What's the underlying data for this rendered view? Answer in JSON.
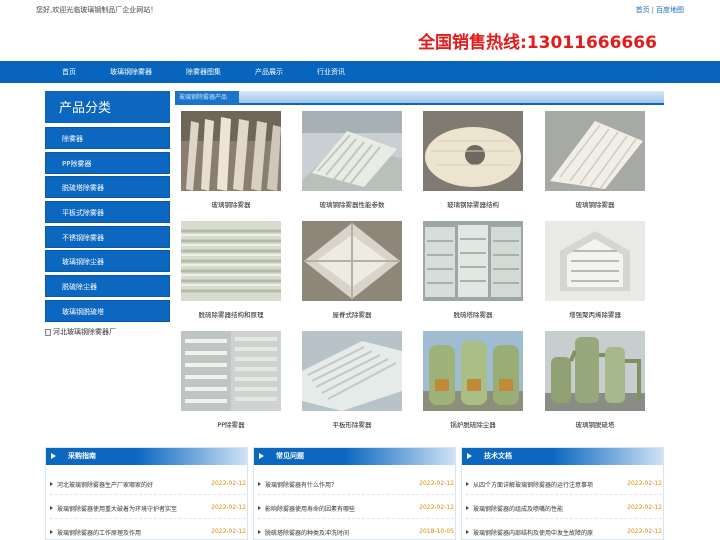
{
  "header": {
    "welcome": "您好,欢迎光临玻璃钢制品厂企业网站！",
    "links": [
      "首页",
      "百度地图"
    ],
    "hotline": "全国销售热线:13011666666"
  },
  "nav": {
    "items": [
      "首页",
      "玻璃钢除雾器",
      "除雾器图集",
      "产品展示",
      "行业资讯"
    ]
  },
  "sidebar": {
    "title": "产品分类",
    "items": [
      "除雾器",
      "PP除雾器",
      "脱硫塔除雾器",
      "平板式除雾器",
      "不锈钢除雾器",
      "玻璃钢除尘器",
      "脱硫除尘器",
      "玻璃钢脱硫塔"
    ],
    "image_alt": "河北玻璃钢除雾器厂"
  },
  "main": {
    "tab": "玻璃钢除雾器产品",
    "products": [
      {
        "name": "玻璃钢除雾器"
      },
      {
        "name": "玻璃钢除雾器性能参数"
      },
      {
        "name": "玻璃钢除雾器结构"
      },
      {
        "name": "玻璃钢除雾器"
      },
      {
        "name": "脱硫除雾器结构和原理"
      },
      {
        "name": "屋脊式除雾器"
      },
      {
        "name": "脱硫塔除雾器"
      },
      {
        "name": "增强聚丙烯除雾器"
      },
      {
        "name": "PP除雾器"
      },
      {
        "name": "平板形除雾器"
      },
      {
        "name": "锅炉脱硫除尘器"
      },
      {
        "name": "玻璃钢脱硫塔"
      }
    ]
  },
  "boxes": [
    {
      "title": "采购指南",
      "rows": [
        {
          "text": "河北玻璃钢除雾器生产厂家哪家的好",
          "date": "2022-02-12"
        },
        {
          "text": "玻璃钢除雾器使用重大破着为环境守护者实至",
          "date": "2022-02-12"
        },
        {
          "text": "玻璃钢除雾器的工作原理及作用",
          "date": "2022-02-12"
        }
      ]
    },
    {
      "title": "常见问题",
      "rows": [
        {
          "text": "玻璃钢除雾器有什么作用？",
          "date": "2022-02-12"
        },
        {
          "text": "影响除雾器使用寿命的因素有哪些",
          "date": "2022-02-12"
        },
        {
          "text": "脱硫塔除雾器的种类及冲洗时间",
          "date": "2018-10-05"
        }
      ]
    },
    {
      "title": "技术文档",
      "rows": [
        {
          "text": "从四个方面详解玻璃钢除雾器的运行注意事项",
          "date": "2022-02-12"
        },
        {
          "text": "玻璃钢除雾器的组成及喷嘴的性能",
          "date": "2022-02-12"
        },
        {
          "text": "玻璃钢除雾器内部结构及使用中发生故障的原",
          "date": "2022-02-12"
        }
      ]
    }
  ]
}
